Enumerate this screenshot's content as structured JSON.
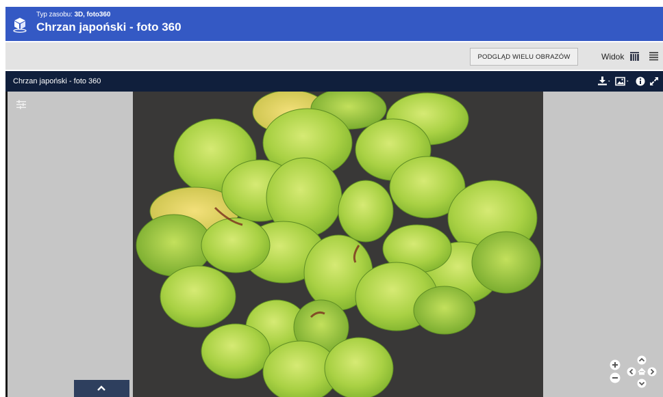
{
  "header": {
    "type_label": "Typ zasobu:",
    "type_value": "3D, foto360",
    "title": "Chrzan japoński - foto 360"
  },
  "toolbar": {
    "multi_view_button": "PODGLĄD WIELU OBRAZÓW",
    "view_label": "Widok"
  },
  "viewer": {
    "title": "Chrzan japoński - foto 360"
  },
  "colors": {
    "header_bg": "#3459c4",
    "toolbar_bg": "#e3e3e3",
    "viewer_bar_bg": "#101f3c",
    "viewer_bg": "#c6c6c6"
  },
  "icons": [
    "cube-icon",
    "grid-view-icon",
    "list-view-icon",
    "download-icon",
    "image-menu-icon",
    "info-icon",
    "fullscreen-icon",
    "adjust-icon",
    "chevron-up-icon",
    "zoom-in-icon",
    "zoom-out-icon",
    "pan-up-icon",
    "pan-down-icon",
    "pan-left-icon",
    "pan-right-icon",
    "home-icon"
  ]
}
